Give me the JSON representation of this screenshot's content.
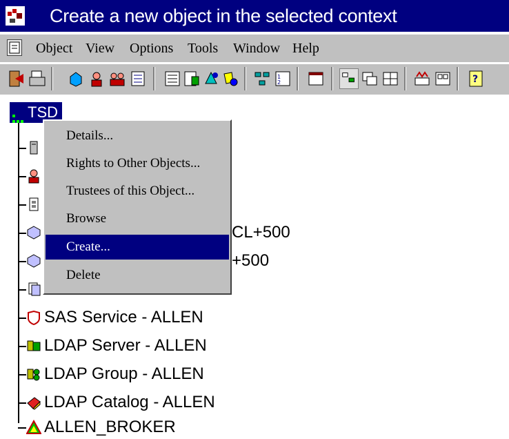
{
  "window": {
    "title": "Create a new object in the selected context"
  },
  "menubar": {
    "items": [
      {
        "label": "Object"
      },
      {
        "label": "View"
      },
      {
        "label": "Options"
      },
      {
        "label": "Tools"
      },
      {
        "label": "Window"
      },
      {
        "label": "Help"
      }
    ]
  },
  "toolbar": {
    "buttons": [
      {
        "icon": "exit-icon"
      },
      {
        "icon": "print-icon"
      },
      {
        "icon": "container-icon"
      },
      {
        "icon": "user-icon"
      },
      {
        "icon": "group-icon"
      },
      {
        "icon": "list-icon"
      },
      {
        "icon": "details-icon"
      },
      {
        "icon": "rights-icon"
      },
      {
        "icon": "browse-icon"
      },
      {
        "icon": "search-icon"
      },
      {
        "icon": "partition-icon"
      },
      {
        "icon": "numbered-list-icon"
      },
      {
        "icon": "window-icon"
      },
      {
        "icon": "tree-view-icon"
      },
      {
        "icon": "cascade-icon"
      },
      {
        "icon": "tile-icon"
      },
      {
        "icon": "chart-icon"
      },
      {
        "icon": "console-icon"
      },
      {
        "icon": "help-icon"
      }
    ]
  },
  "tree": {
    "root": {
      "label": "TSD"
    },
    "items": [
      {
        "icon": "server-icon",
        "label": ""
      },
      {
        "icon": "user-icon",
        "label": ""
      },
      {
        "icon": "volume-icon",
        "label": ""
      },
      {
        "icon": "volume-icon",
        "label": "",
        "suffix": "CL+500"
      },
      {
        "icon": "volume-icon",
        "label": "",
        "suffix": "+500"
      },
      {
        "icon": "document-icon",
        "label": ""
      },
      {
        "icon": "sas-service-icon",
        "label": "SAS Service - ALLEN"
      },
      {
        "icon": "ldap-server-icon",
        "label": "LDAP Server - ALLEN"
      },
      {
        "icon": "ldap-group-icon",
        "label": "LDAP Group - ALLEN"
      },
      {
        "icon": "ldap-catalog-icon",
        "label": "LDAP Catalog - ALLEN"
      },
      {
        "icon": "broker-icon",
        "label": "ALLEN_BROKER"
      }
    ]
  },
  "context_menu": {
    "items": [
      {
        "label": "Details..."
      },
      {
        "label": "Rights to Other Objects..."
      },
      {
        "label": "Trustees of this Object..."
      },
      {
        "label": "Browse"
      },
      {
        "label": "Create...",
        "active": true
      },
      {
        "label": "Delete"
      }
    ]
  },
  "colors": {
    "titlebar": "#000080",
    "selection": "#000080",
    "chrome": "#c0c0c0"
  }
}
